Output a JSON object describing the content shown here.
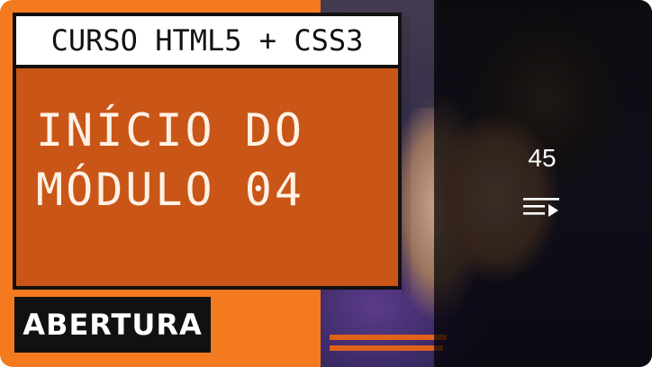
{
  "thumbnail": {
    "course_label": "CURSO HTML5 + CSS3",
    "title_line1": "INÍCIO DO",
    "title_line2": "MÓDULO 04",
    "tag_label": "ABERTURA",
    "video_count": "45",
    "overlay_icon": "playlist-play-icon"
  },
  "colors": {
    "background": "#f47a20",
    "panel": "#c95617",
    "title_text": "#fff2e6",
    "tag_bg": "#111111",
    "overlay": "rgba(0,0,0,0.72)"
  }
}
